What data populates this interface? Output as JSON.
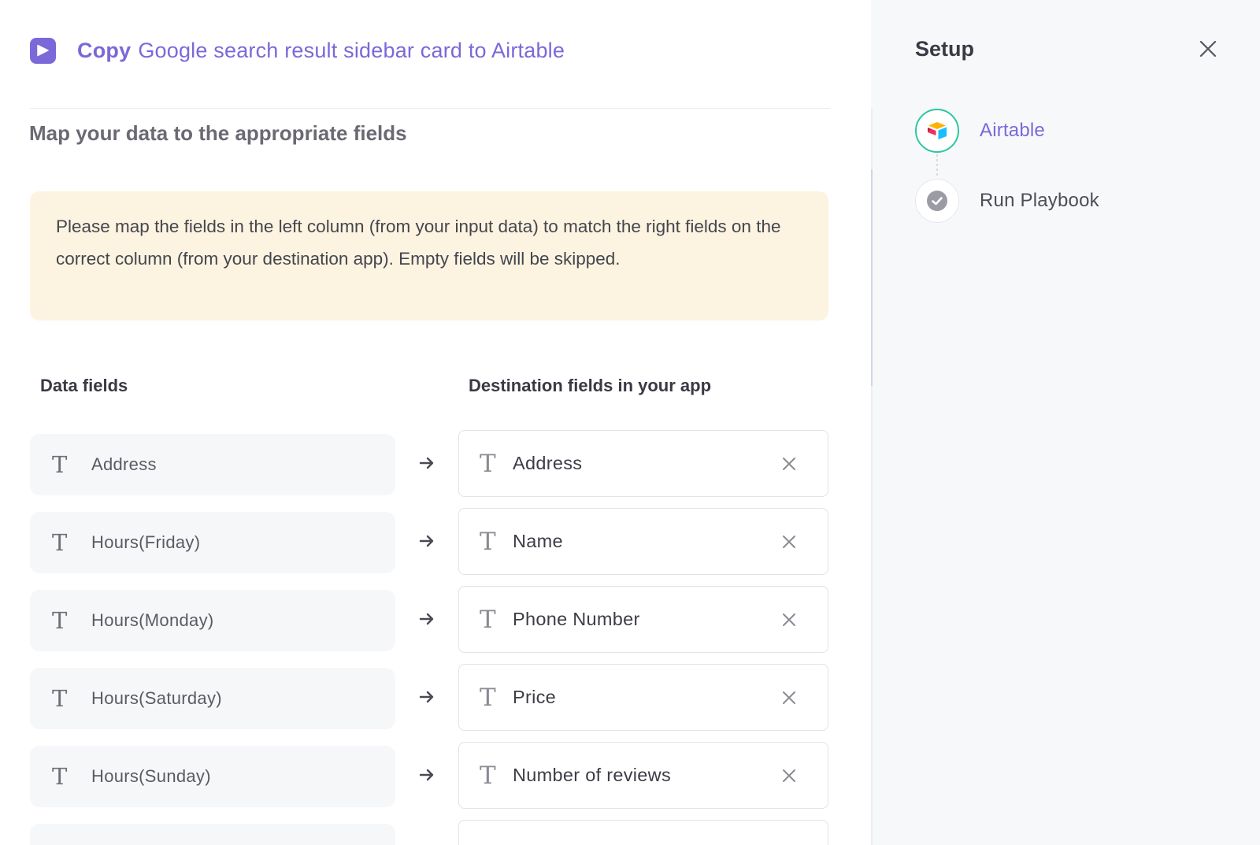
{
  "header": {
    "title_verb": "Copy",
    "title_rest": "Google search result sidebar card to Airtable"
  },
  "main": {
    "section_title": "Map your data to the appropriate fields",
    "notice": "Please map the fields in the left column (from your input data) to match the right fields on the correct column (from your destination app). Empty fields will be skipped.",
    "columns": {
      "left": "Data fields",
      "right": "Destination fields in your app"
    },
    "mappings": [
      {
        "source": "Address",
        "destination": "Address"
      },
      {
        "source": "Hours(Friday)",
        "destination": "Name"
      },
      {
        "source": "Hours(Monday)",
        "destination": "Phone Number"
      },
      {
        "source": "Hours(Saturday)",
        "destination": "Price"
      },
      {
        "source": "Hours(Sunday)",
        "destination": "Number of reviews"
      }
    ],
    "field_type_glyph": "T"
  },
  "sidebar": {
    "title": "Setup",
    "steps": [
      {
        "label": "Airtable",
        "state": "active",
        "icon": "airtable-icon"
      },
      {
        "label": "Run Playbook",
        "state": "pending",
        "icon": "check-circle-icon"
      }
    ]
  },
  "colors": {
    "accent": "#7b68d9",
    "active_step_ring": "#2dc6a4",
    "notice_bg": "#fcf4e0",
    "sidebar_bg": "#f7f8fa"
  }
}
